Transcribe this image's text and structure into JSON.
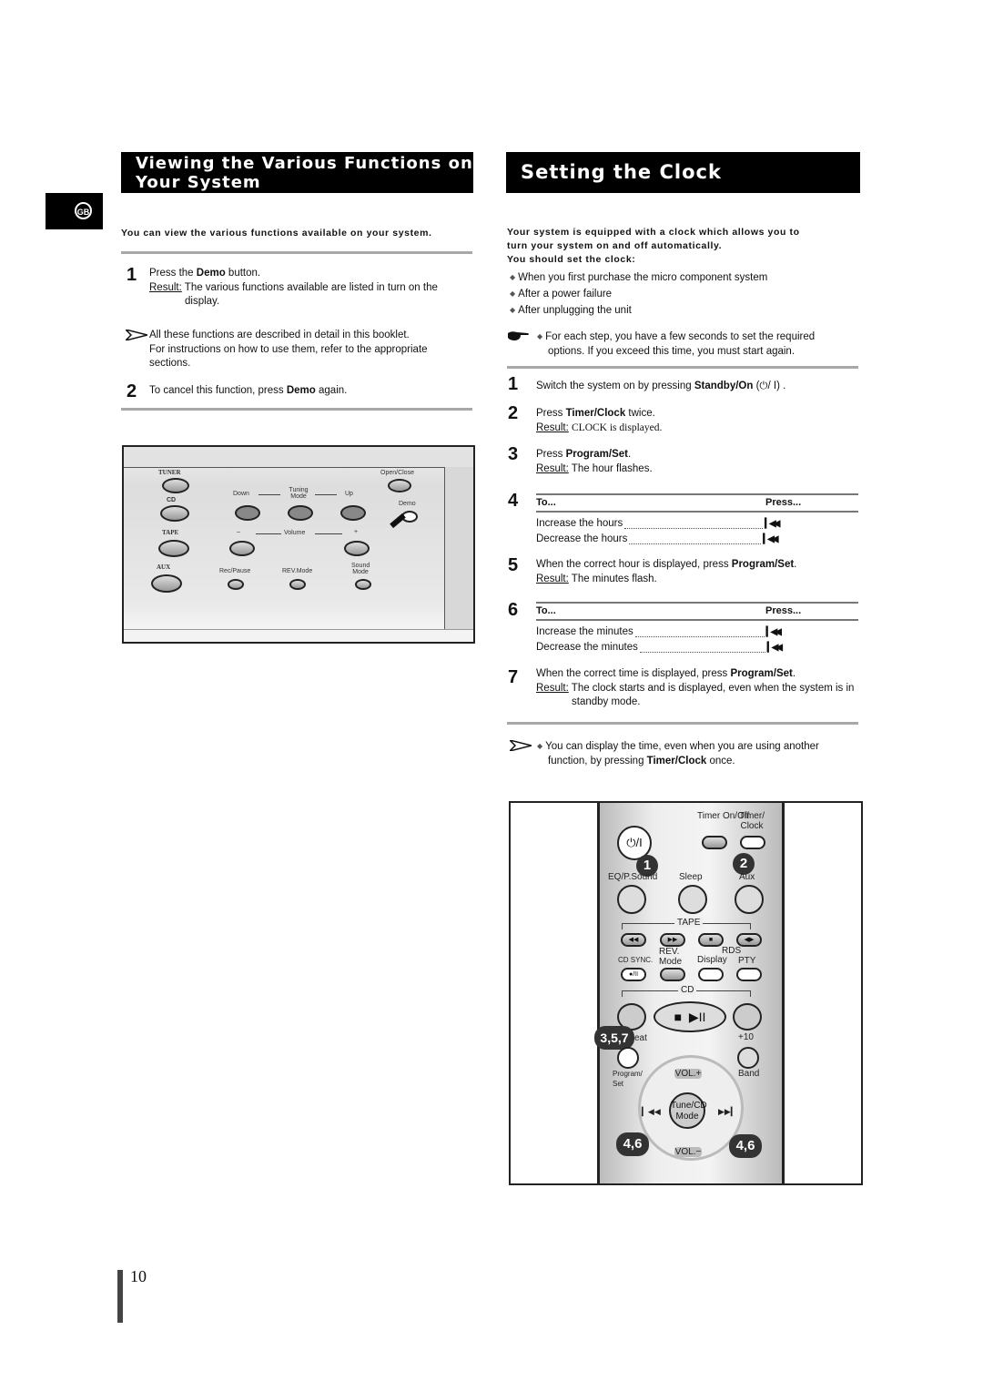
{
  "language_tab": "GB",
  "page_number": "10",
  "left_section": {
    "title_line1": "Viewing the Various Functions on",
    "title_line2": "Your System",
    "lead": "You can view the various functions available on your system.",
    "step1": {
      "num": "1",
      "text_pre": "Press the ",
      "text_bold": "Demo",
      "text_post": " button.",
      "result_label": "Result:",
      "result_text": "The various functions available are listed in turn on the",
      "result_cont": "display."
    },
    "note": {
      "icon": "arrow-note-icon",
      "line1": "All these functions are described in detail in this booklet.",
      "line2": "For instructions on how to use them, refer to the appropriate",
      "line3": "sections."
    },
    "step2": {
      "num": "2",
      "text_pre": "To cancel this function, press ",
      "text_bold": "Demo",
      "text_post": " again."
    },
    "panel": {
      "labels": {
        "tuner": "TUNER",
        "cd": "CD",
        "tape": "TAPE",
        "aux": "AUX",
        "down": "Down",
        "tuning_mode": "Tuning Mode",
        "up": "Up",
        "open_close": "Open/Close",
        "demo": "Demo",
        "vol_minus": "–",
        "volume": "Volume",
        "vol_plus": "+",
        "rec_pause": "Rec/Pause",
        "rev_mode": "REV.Mode",
        "sound_mode": "Sound Mode"
      }
    }
  },
  "right_section": {
    "title": "Setting the Clock",
    "lead_line1": "Your system is equipped with a clock which allows you to",
    "lead_line2": "turn your system on and off automatically.",
    "lead_line3": "You should set the clock:",
    "bullets": [
      "When you first purchase the micro component system",
      "After a power failure",
      "After unplugging the unit"
    ],
    "tip": {
      "icon": "pointing-hand-icon",
      "line1": "For each step, you have a few seconds to set the required",
      "line2": "options. If you exceed this time, you must start again."
    },
    "steps": {
      "s1": {
        "num": "1",
        "pre": "Switch the system on by pressing ",
        "bold": "Standby/On",
        "post": " (⏻/ I) ."
      },
      "s2": {
        "num": "2",
        "pre": "Press ",
        "bold": "Timer/Clock",
        "post": " twice.",
        "result_label": "Result:",
        "result": "CLOCK is displayed."
      },
      "s3": {
        "num": "3",
        "pre": "Press ",
        "bold": "Program/Set",
        "post": ".",
        "result_label": "Result:",
        "result": "The hour flashes."
      },
      "s4": {
        "num": "4",
        "col_to": "To...",
        "col_press": "Press...",
        "rows": [
          {
            "action": "Increase the hours",
            "key": "previous-icon"
          },
          {
            "action": "Decrease the hours",
            "key": "previous-icon"
          }
        ]
      },
      "s5": {
        "num": "5",
        "pre": "When the correct hour is displayed, press ",
        "bold": "Program/Set",
        "post": ".",
        "result_label": "Result:",
        "result": "The minutes flash."
      },
      "s6": {
        "num": "6",
        "col_to": "To...",
        "col_press": "Press...",
        "rows": [
          {
            "action": "Increase the minutes",
            "key": "previous-icon"
          },
          {
            "action": "Decrease the minutes",
            "key": "previous-icon"
          }
        ]
      },
      "s7": {
        "num": "7",
        "pre": "When the correct time is displayed, press ",
        "bold": "Program/Set",
        "post": ".",
        "result_label": "Result:",
        "result": "The clock starts and is displayed, even when the system is in",
        "result_cont": "standby mode."
      }
    },
    "note": {
      "icon": "arrow-note-icon",
      "line1": "You can display the time, even when you are using another",
      "line2_pre": "function, by pressing ",
      "line2_bold": "Timer/Clock",
      "line2_post": " once."
    },
    "remote": {
      "labels": {
        "power": "⏻/I",
        "timer_onoff": "Timer On/Off",
        "timer_clock": "Timer/ Clock",
        "eq": "EQ/P.Sound",
        "sleep": "Sleep",
        "aux": "Aux",
        "tape": "TAPE",
        "cd_sync": "CD SYNC.",
        "rev_mode": "REV. Mode",
        "rds": "RDS",
        "display": "Display",
        "pty": "PTY",
        "cd": "CD",
        "repeat": "eat",
        "plus10": "+10",
        "program_set": "Program/ Set",
        "band": "Band",
        "vol_plus": "VOL.+",
        "vol_minus": "VOL.−",
        "tune_cd": "Tune/CD Mode"
      },
      "callouts": [
        "1",
        "2",
        "3,5,7",
        "4,6",
        "4,6"
      ]
    }
  }
}
